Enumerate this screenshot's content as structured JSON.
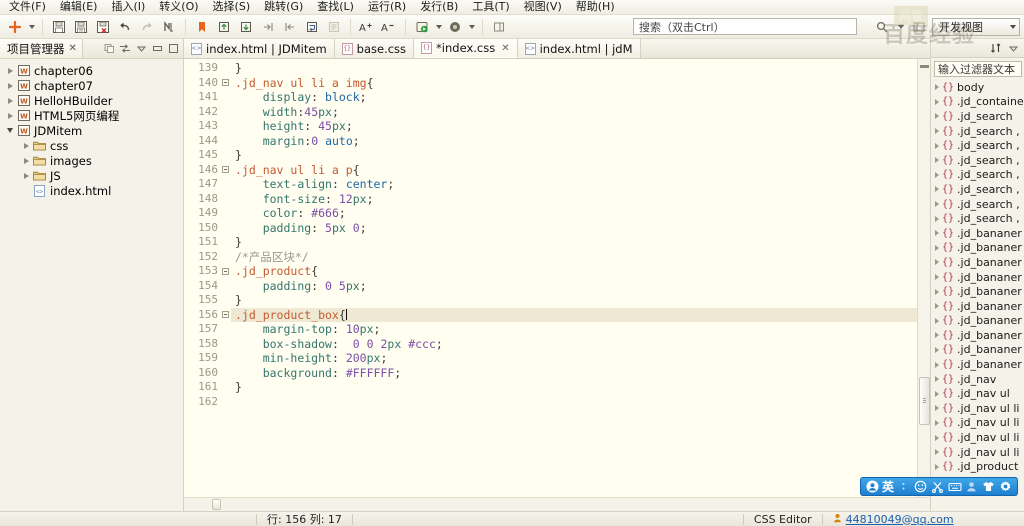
{
  "menu": {
    "items": [
      {
        "label": "文件(F)",
        "name": "menu-file"
      },
      {
        "label": "编辑(E)",
        "name": "menu-edit"
      },
      {
        "label": "插入(I)",
        "name": "menu-insert"
      },
      {
        "label": "转义(O)",
        "name": "menu-escape"
      },
      {
        "label": "选择(S)",
        "name": "menu-select"
      },
      {
        "label": "跳转(G)",
        "name": "menu-goto"
      },
      {
        "label": "查找(L)",
        "name": "menu-find"
      },
      {
        "label": "运行(R)",
        "name": "menu-run"
      },
      {
        "label": "发行(B)",
        "name": "menu-publish"
      },
      {
        "label": "工具(T)",
        "name": "menu-tools"
      },
      {
        "label": "视图(V)",
        "name": "menu-view"
      },
      {
        "label": "帮助(H)",
        "name": "menu-help"
      }
    ]
  },
  "toolbar": {
    "buttons": [
      {
        "icon": "new-plus-icon",
        "name": "new-file-button"
      },
      {
        "icon": "chevron-down-icon",
        "name": "new-file-dropdown"
      },
      {
        "icon": "save-icon",
        "name": "save-button"
      },
      {
        "icon": "save-all-icon",
        "name": "save-all-button"
      },
      {
        "icon": "save-close-icon",
        "name": "save-close-button"
      },
      {
        "icon": "undo-icon",
        "name": "undo-button"
      },
      {
        "icon": "redo-icon",
        "name": "redo-button"
      },
      {
        "icon": "format-icon",
        "name": "format-code-button"
      },
      {
        "icon": "bookmark-icon",
        "name": "bookmark-button"
      },
      {
        "icon": "bookmark-prev-icon",
        "name": "prev-bookmark-button"
      },
      {
        "icon": "bookmark-next-icon",
        "name": "next-bookmark-button"
      },
      {
        "icon": "indent-right-icon",
        "name": "indent-button"
      },
      {
        "icon": "indent-left-icon",
        "name": "outdent-button"
      },
      {
        "icon": "wrap-icon",
        "name": "toggle-wrap-button"
      },
      {
        "icon": "comment-icon",
        "name": "comment-button"
      },
      {
        "icon": "font-increase-icon",
        "name": "font-increase-button"
      },
      {
        "icon": "font-decrease-icon",
        "name": "font-decrease-button"
      },
      {
        "icon": "run-icon",
        "name": "run-button"
      },
      {
        "icon": "chevron-down-icon",
        "name": "run-dropdown"
      },
      {
        "icon": "preview-icon",
        "name": "preview-button"
      },
      {
        "icon": "chevron-down-icon",
        "name": "preview-dropdown"
      },
      {
        "icon": "panel-icon",
        "name": "toggle-panel-button"
      }
    ],
    "search_placeholder": "搜索（双击Ctrl）",
    "search_value": "",
    "view_combo_label": "开发视图"
  },
  "left_panel": {
    "tab_label": "项目管理器",
    "tab_close": "✕",
    "tools": [
      "collapse-all-icon",
      "link-editor-icon",
      "view-menu-icon",
      "minimize-icon",
      "maximize-icon"
    ],
    "tree": [
      {
        "label": "chapter06",
        "icon": "project-icon",
        "depth": 0,
        "expanded": false
      },
      {
        "label": "chapter07",
        "icon": "project-icon",
        "depth": 0,
        "expanded": false
      },
      {
        "label": "HelloHBuilder",
        "icon": "project-icon",
        "depth": 0,
        "expanded": false
      },
      {
        "label": "HTML5网页编程",
        "icon": "project-icon",
        "depth": 0,
        "expanded": false
      },
      {
        "label": "JDMitem",
        "icon": "project-icon",
        "depth": 0,
        "expanded": true
      },
      {
        "label": "css",
        "icon": "folder-icon",
        "depth": 1,
        "expanded": false
      },
      {
        "label": "images",
        "icon": "folder-icon",
        "depth": 1,
        "expanded": false
      },
      {
        "label": "JS",
        "icon": "folder-icon",
        "depth": 1,
        "expanded": false
      },
      {
        "label": "index.html",
        "icon": "html-file-icon",
        "depth": 1,
        "expanded": null
      }
    ]
  },
  "editor": {
    "tabs": [
      {
        "label": "index.html | JDMitem",
        "icon": "html-file-icon",
        "active": false,
        "closable": false
      },
      {
        "label": "base.css",
        "icon": "css-file-icon",
        "active": false,
        "closable": false
      },
      {
        "label": "*index.css",
        "icon": "css-file-icon",
        "active": true,
        "closable": true
      },
      {
        "label": "index.html | jdM",
        "icon": "html-file-icon",
        "active": false,
        "closable": false
      }
    ],
    "tab_close": "✕",
    "first_line": 139,
    "current_line": 156,
    "fold_lines": [
      140,
      146,
      153,
      156
    ],
    "lines": [
      {
        "n": 139,
        "tokens": [
          {
            "t": "}",
            "c": "pun"
          }
        ]
      },
      {
        "n": 140,
        "tokens": [
          {
            "t": ".jd_nav ul li a img",
            "c": "sel"
          },
          {
            "t": "{",
            "c": "pun"
          }
        ]
      },
      {
        "n": 141,
        "tokens": [
          {
            "t": "    ",
            "c": "pun"
          },
          {
            "t": "display",
            "c": "prop"
          },
          {
            "t": ": ",
            "c": "pun"
          },
          {
            "t": "block",
            "c": "kw"
          },
          {
            "t": ";",
            "c": "pun"
          }
        ]
      },
      {
        "n": 142,
        "tokens": [
          {
            "t": "    ",
            "c": "pun"
          },
          {
            "t": "width",
            "c": "prop"
          },
          {
            "t": ":",
            "c": "pun"
          },
          {
            "t": "45",
            "c": "val"
          },
          {
            "t": "px",
            "c": "prop"
          },
          {
            "t": ";",
            "c": "pun"
          }
        ]
      },
      {
        "n": 143,
        "tokens": [
          {
            "t": "    ",
            "c": "pun"
          },
          {
            "t": "height",
            "c": "prop"
          },
          {
            "t": ": ",
            "c": "pun"
          },
          {
            "t": "45",
            "c": "val"
          },
          {
            "t": "px",
            "c": "prop"
          },
          {
            "t": ";",
            "c": "pun"
          }
        ]
      },
      {
        "n": 144,
        "tokens": [
          {
            "t": "    ",
            "c": "pun"
          },
          {
            "t": "margin",
            "c": "prop"
          },
          {
            "t": ":",
            "c": "pun"
          },
          {
            "t": "0",
            "c": "val"
          },
          {
            "t": " ",
            "c": "pun"
          },
          {
            "t": "auto",
            "c": "kw"
          },
          {
            "t": ";",
            "c": "pun"
          }
        ]
      },
      {
        "n": 145,
        "tokens": [
          {
            "t": "}",
            "c": "pun"
          }
        ]
      },
      {
        "n": 146,
        "tokens": [
          {
            "t": ".jd_nav ul li a p",
            "c": "sel"
          },
          {
            "t": "{",
            "c": "pun"
          }
        ]
      },
      {
        "n": 147,
        "tokens": [
          {
            "t": "    ",
            "c": "pun"
          },
          {
            "t": "text-align",
            "c": "prop"
          },
          {
            "t": ": ",
            "c": "pun"
          },
          {
            "t": "center",
            "c": "kw"
          },
          {
            "t": ";",
            "c": "pun"
          }
        ]
      },
      {
        "n": 148,
        "tokens": [
          {
            "t": "    ",
            "c": "pun"
          },
          {
            "t": "font-size",
            "c": "prop"
          },
          {
            "t": ": ",
            "c": "pun"
          },
          {
            "t": "12",
            "c": "val"
          },
          {
            "t": "px",
            "c": "prop"
          },
          {
            "t": ";",
            "c": "pun"
          }
        ]
      },
      {
        "n": 149,
        "tokens": [
          {
            "t": "    ",
            "c": "pun"
          },
          {
            "t": "color",
            "c": "prop"
          },
          {
            "t": ": ",
            "c": "pun"
          },
          {
            "t": "#666",
            "c": "val"
          },
          {
            "t": ";",
            "c": "pun"
          }
        ]
      },
      {
        "n": 150,
        "tokens": [
          {
            "t": "    ",
            "c": "pun"
          },
          {
            "t": "padding",
            "c": "prop"
          },
          {
            "t": ": ",
            "c": "pun"
          },
          {
            "t": "5",
            "c": "val"
          },
          {
            "t": "px ",
            "c": "prop"
          },
          {
            "t": "0",
            "c": "val"
          },
          {
            "t": ";",
            "c": "pun"
          }
        ]
      },
      {
        "n": 151,
        "tokens": [
          {
            "t": "}",
            "c": "pun"
          }
        ]
      },
      {
        "n": 152,
        "tokens": [
          {
            "t": "/*产品区块*/",
            "c": "cmt"
          }
        ]
      },
      {
        "n": 153,
        "tokens": [
          {
            "t": ".jd_product",
            "c": "sel"
          },
          {
            "t": "{",
            "c": "pun"
          }
        ]
      },
      {
        "n": 154,
        "tokens": [
          {
            "t": "    ",
            "c": "pun"
          },
          {
            "t": "padding",
            "c": "prop"
          },
          {
            "t": ": ",
            "c": "pun"
          },
          {
            "t": "0",
            "c": "val"
          },
          {
            "t": " ",
            "c": "pun"
          },
          {
            "t": "5",
            "c": "val"
          },
          {
            "t": "px",
            "c": "prop"
          },
          {
            "t": ";",
            "c": "pun"
          }
        ]
      },
      {
        "n": 155,
        "tokens": [
          {
            "t": "}",
            "c": "pun"
          }
        ]
      },
      {
        "n": 156,
        "tokens": [
          {
            "t": ".jd_product_box",
            "c": "sel"
          },
          {
            "t": "{",
            "c": "pun"
          }
        ],
        "cursor": true
      },
      {
        "n": 157,
        "tokens": [
          {
            "t": "    ",
            "c": "pun"
          },
          {
            "t": "margin-top",
            "c": "prop"
          },
          {
            "t": ": ",
            "c": "pun"
          },
          {
            "t": "10",
            "c": "val"
          },
          {
            "t": "px",
            "c": "prop"
          },
          {
            "t": ";",
            "c": "pun"
          }
        ]
      },
      {
        "n": 158,
        "tokens": [
          {
            "t": "    ",
            "c": "pun"
          },
          {
            "t": "box-shadow",
            "c": "prop"
          },
          {
            "t": ":  ",
            "c": "pun"
          },
          {
            "t": "0",
            "c": "val"
          },
          {
            "t": " ",
            "c": "pun"
          },
          {
            "t": "0",
            "c": "val"
          },
          {
            "t": " ",
            "c": "pun"
          },
          {
            "t": "2",
            "c": "val"
          },
          {
            "t": "px ",
            "c": "prop"
          },
          {
            "t": "#ccc",
            "c": "val"
          },
          {
            "t": ";",
            "c": "pun"
          }
        ]
      },
      {
        "n": 159,
        "tokens": [
          {
            "t": "    ",
            "c": "pun"
          },
          {
            "t": "min-height",
            "c": "prop"
          },
          {
            "t": ": ",
            "c": "pun"
          },
          {
            "t": "200",
            "c": "val"
          },
          {
            "t": "px",
            "c": "prop"
          },
          {
            "t": ";",
            "c": "pun"
          }
        ]
      },
      {
        "n": 160,
        "tokens": [
          {
            "t": "    ",
            "c": "pun"
          },
          {
            "t": "background",
            "c": "prop"
          },
          {
            "t": ": ",
            "c": "pun"
          },
          {
            "t": "#FFFFFF",
            "c": "val"
          },
          {
            "t": ";",
            "c": "pun"
          }
        ]
      },
      {
        "n": 161,
        "tokens": [
          {
            "t": "}",
            "c": "pun"
          }
        ]
      },
      {
        "n": 162,
        "tokens": []
      }
    ]
  },
  "outline": {
    "head_icons": [
      "sort-icon",
      "view-menu-icon"
    ],
    "filter_placeholder": "输入过滤器文本",
    "items": [
      "body",
      ".jd_containe",
      ".jd_search",
      ".jd_search ,",
      ".jd_search ,",
      ".jd_search ,",
      ".jd_search ,",
      ".jd_search ,",
      ".jd_search ,",
      ".jd_search ,",
      ".jd_bananer",
      ".jd_bananer",
      ".jd_bananer",
      ".jd_bananer",
      ".jd_bananer",
      ".jd_bananer",
      ".jd_bananer",
      ".jd_bananer",
      ".jd_bananer",
      ".jd_bananer",
      ".jd_nav",
      ".jd_nav ul",
      ".jd_nav ul li",
      ".jd_nav ul li",
      ".jd_nav ul li",
      ".jd_nav ul li",
      ".jd_product"
    ]
  },
  "ime": {
    "lang": "英",
    "icons": [
      "sogou-logo-icon",
      "emoji-icon",
      "scissors-icon",
      "keyboard-icon",
      "user-icon",
      "skin-icon",
      "settings-gear-icon"
    ]
  },
  "statusbar": {
    "position": "行: 156 列: 17",
    "editor_type": "CSS Editor",
    "account": "44810049@qq.com",
    "account_icon": "user-icon"
  },
  "watermark": {
    "text": "百度经验",
    "badge": "网管"
  },
  "colors": {
    "selector": "#c45a2e",
    "property": "#35756d",
    "value": "#7b4ea8",
    "keyword": "#1d68a7",
    "comment": "#9b998a",
    "editor_bg": "#fffef0",
    "current_line_bg": "#efe9d4",
    "chrome_bg": "#f4f2e9",
    "ime_blue": "#2f8fdc"
  }
}
